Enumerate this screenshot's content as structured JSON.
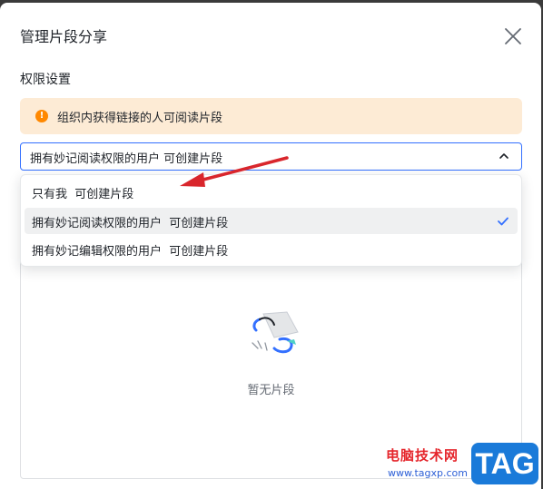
{
  "dialog": {
    "title": "管理片段分享",
    "section_label": "权限设置",
    "notice": {
      "icon": "warning-circle-icon",
      "icon_glyph": "!",
      "text": "组织内获得链接的人可阅读片段",
      "color": "#fdebd5",
      "icon_color": "#ff8800"
    },
    "select": {
      "value": "拥有妙记阅读权限的用户  可创建片段",
      "border_color": "#3370ff"
    },
    "dropdown": {
      "options": [
        {
          "label": "只有我  可创建片段",
          "selected": false
        },
        {
          "label": "拥有妙记阅读权限的用户  可创建片段",
          "selected": true
        },
        {
          "label": "拥有妙记编辑权限的用户  可创建片段",
          "selected": false
        }
      ]
    },
    "empty_state": {
      "text": "暂无片段"
    }
  },
  "annotation": {
    "arrow_color": "#d9262c"
  },
  "watermark": {
    "site_name": "电脑技术网",
    "url": "www.tagxp.com",
    "tag": "TAG"
  }
}
